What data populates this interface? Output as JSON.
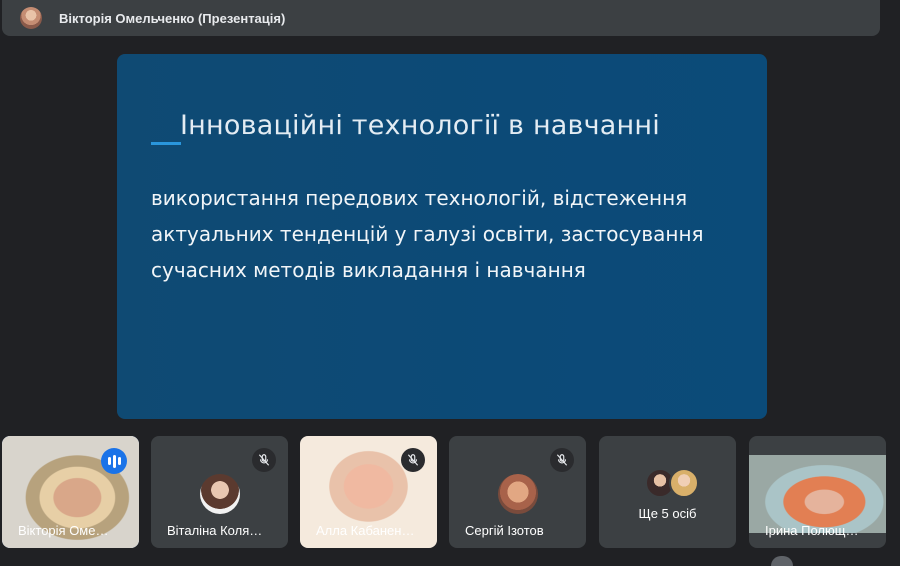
{
  "header": {
    "presenter_title": "Вікторія Омельченко (Презентація)"
  },
  "slide": {
    "heading": "Інноваційні технології в навчанні",
    "body": "використання передових технологій, відстеження актуальних тенденцій у галузі освіти, застосування сучасних методів викладання і навчання",
    "background_color": "#0f4c75",
    "accent_color": "#2a96dc"
  },
  "participants": [
    {
      "name": "Вікторія Оме…",
      "state": "speaking",
      "icon": "speaking-icon"
    },
    {
      "name": "Віталіна Коля…",
      "state": "muted",
      "icon": "mic-off-icon"
    },
    {
      "name": "Алла Кабанен…",
      "state": "muted",
      "icon": "mic-off-icon"
    },
    {
      "name": "Сергій Ізотов",
      "state": "muted",
      "icon": "mic-off-icon"
    },
    {
      "name": "Ще 5 осіб",
      "state": "overflow"
    },
    {
      "name": "Ірина Полющ…",
      "state": "video"
    }
  ],
  "colors": {
    "background": "#202124",
    "tile": "#3c4043",
    "active_border": "#8ab4f8",
    "speaking": "#1a73e8"
  }
}
